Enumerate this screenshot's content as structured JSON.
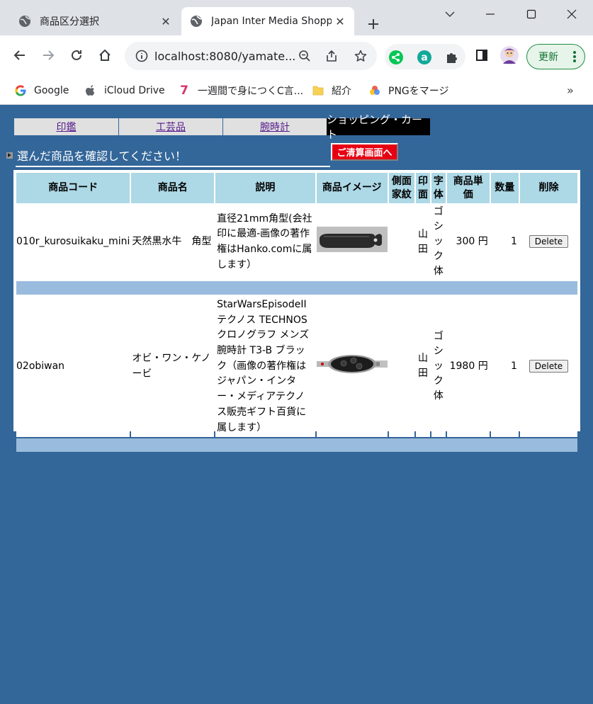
{
  "browser": {
    "tabs": [
      {
        "title": "商品区分選択",
        "favicon": "globe-icon",
        "active": false
      },
      {
        "title": "Japan Inter Media Shopp",
        "favicon": "globe-icon",
        "active": true
      }
    ],
    "url": "localhost:8080/yamate...",
    "update_label": "更新",
    "bookmarks": [
      {
        "label": "Google",
        "icon": "google-icon"
      },
      {
        "label": "iCloud Drive",
        "icon": "apple-icon"
      },
      {
        "label": "一週間で身につくC言...",
        "icon": "seven-icon"
      },
      {
        "label": "紹介",
        "icon": "folder-icon"
      },
      {
        "label": "PNGをマージ",
        "icon": "png-merge-icon"
      }
    ],
    "bookmarks_more": "»"
  },
  "nav": {
    "categories": [
      "印鑑",
      "工芸品",
      "腕時計"
    ],
    "cart_label": "ショッピング・カート"
  },
  "confirm": {
    "text": "選んだ商品を確認してください！",
    "checkout_label": "ご清算画面へ"
  },
  "cart": {
    "headers": {
      "code": "商品コード",
      "name": "商品名",
      "desc": "説明",
      "image": "商品イメージ",
      "side": "側面家紋",
      "seal": "印面",
      "font": "字体",
      "price": "商品単価",
      "qty": "数量",
      "delete": "削除"
    },
    "items": [
      {
        "code": "010r_kurosuikaku_mini",
        "name": "天然黒水牛　角型",
        "desc": "直径21mm角型(会社印に最適-画像の著作権はHanko.comに属します）",
        "side": "",
        "seal": "山田",
        "font": "ゴシック体",
        "price": "300 円",
        "qty": "1",
        "delete_label": "Delete"
      },
      {
        "code": "02obiwan",
        "name": "オビ・ワン・ケノービ",
        "desc": "StarWarsEpisodeII テクノス TECHNOS クロノグラフ メンズ 腕時計 T3-B ブラック（画像の著作権はジャパン・インター・メディアテクノス販売ギフト百貨に属します）",
        "side": "",
        "seal": "山田",
        "font": "ゴシック体",
        "price": "1980 円",
        "qty": "1",
        "delete_label": "Delete"
      }
    ]
  },
  "colors": {
    "page_bg": "#336699",
    "header_bg": "#add8e6",
    "separator": "#99bbdd",
    "checkout_bg": "#e60012"
  }
}
